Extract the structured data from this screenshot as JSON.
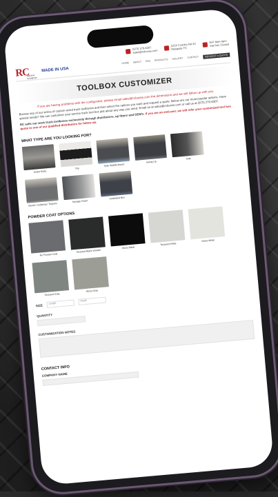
{
  "header": {
    "logo": "RC",
    "logo_sub": "ROUGH COUNTRY",
    "made_in": "MADE IN USA",
    "contacts": [
      {
        "line1": "(972) 270-6307",
        "line2": "sales@rcboxes.com"
      },
      {
        "line1": "2315 Country Rd 23",
        "line2": "Mesquite TX"
      },
      {
        "line1": "M-F 8am-4pm",
        "line2": "Sat-Sun Closed"
      }
    ],
    "nav": [
      "HOME",
      "ABOUT",
      "FAQ",
      "PRODUCTS",
      "GALLERY",
      "CONTACT",
      "REQUEST A QUOTE"
    ]
  },
  "page": {
    "title": "TOOLBOX CUSTOMIZER",
    "intro_red": "If you are having problems with the configurator, please email sales@rcboxes.com the dimensions and we will follow up with you.",
    "intro": "Browse any of our series of custom-sized truck toolboxes and then select the options you want and request a quote. Below are our most popular options. Have special needs? We can customize your service truck tool box just about any way you need. Email us at sales@rcboxes.com or call us at (972) 270-6307.",
    "dealer_text": "RC sells our work truck toolboxes exclusively through distributors, up fitters and OEM's.",
    "dealer_red": "If you are an end-user, we will refer your customized tool box quote to one of our qualified distributors for follow up."
  },
  "type_section": {
    "heading": "WHAT TYPE ARE YOU LOOKING FOR?",
    "items": [
      {
        "label": "Under Body"
      },
      {
        "label": "Top"
      },
      {
        "label": "Side Saddle Mount"
      },
      {
        "label": "Swing Up"
      },
      {
        "label": "Side"
      },
      {
        "label": "Bench / Gullwing / Toppers"
      },
      {
        "label": "Storage Tower"
      },
      {
        "label": "Underbed Box"
      }
    ]
  },
  "finish_section": {
    "heading": "POWDER COAT OPTIONS",
    "swatches": [
      {
        "label": "No Powder Coat",
        "color": "#6b6c70"
      },
      {
        "label": "Textured Black Wrinkle",
        "color": "#2a2c2b"
      },
      {
        "label": "Gloss Black",
        "color": "#0c0c0c"
      },
      {
        "label": "Textured White",
        "color": "#d6d6d2"
      },
      {
        "label": "Gloss White",
        "color": "#e4e4df"
      },
      {
        "label": "Textured Gray",
        "color": "#7f8581"
      },
      {
        "label": "Gloss Gray",
        "color": "#9c9e95"
      }
    ]
  },
  "form": {
    "size_label": "SIZE",
    "size_options": [
      "Length",
      "Depth"
    ],
    "quantity_label": "QUANTITY",
    "notes_label": "CUSTOMIZATION NOTES",
    "contact_heading": "CONTACT INFO",
    "company_label": "COMPANY NAME"
  }
}
